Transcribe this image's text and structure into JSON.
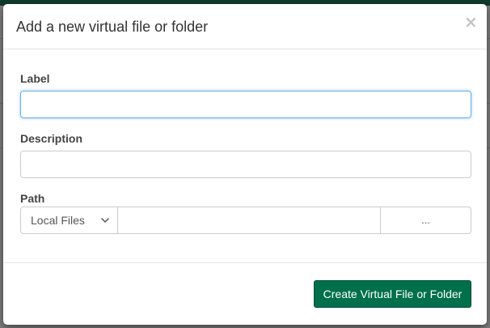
{
  "modal": {
    "title": "Add a new virtual file or folder",
    "close_label": "×",
    "fields": {
      "label": {
        "label": "Label",
        "value": "",
        "placeholder": ""
      },
      "description": {
        "label": "Description",
        "value": "",
        "placeholder": ""
      },
      "path": {
        "label": "Path",
        "source_selected": "Local Files",
        "value": "",
        "browse_label": "..."
      }
    },
    "footer": {
      "submit_label": "Create Virtual File or Folder"
    }
  },
  "icons": {
    "close": "close-icon",
    "dropdown": "chevron-down-icon"
  },
  "colors": {
    "primary_button": "#00704a",
    "primary_button_border": "#004a31",
    "focus_border": "#66afe9",
    "top_bar": "#0f3b2c",
    "overlay": "#7d7d7d"
  }
}
